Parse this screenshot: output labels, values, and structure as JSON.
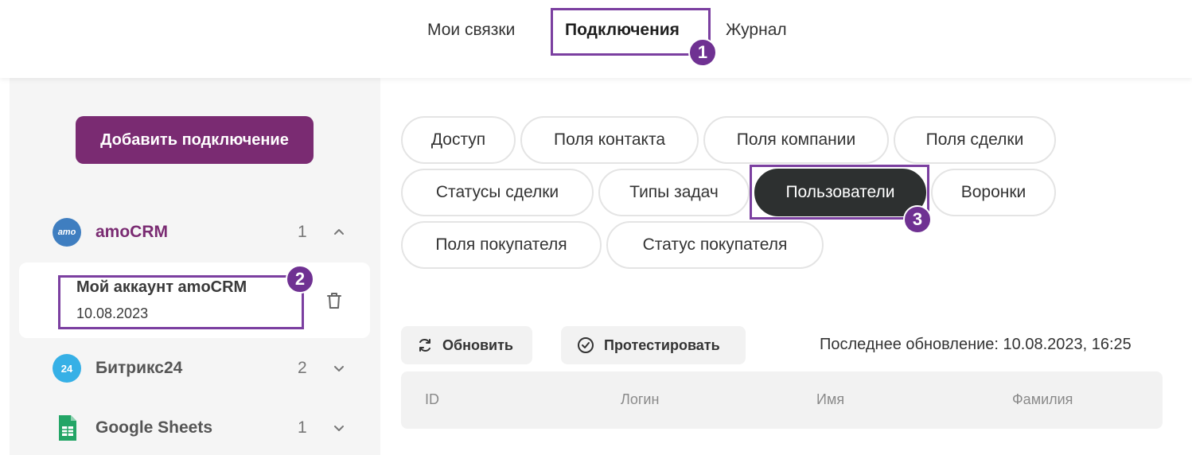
{
  "nav": {
    "tabs": [
      {
        "label": "Мои связки"
      },
      {
        "label": "Подключения",
        "active": true
      },
      {
        "label": "Журнал"
      }
    ]
  },
  "annotations": [
    "1",
    "2",
    "3"
  ],
  "sidebar": {
    "add_button": "Добавить подключение",
    "providers": [
      {
        "name": "amoCRM",
        "count": "1",
        "logo_text": "amo",
        "expanded": true,
        "color": "#3f7ec0"
      },
      {
        "name": "Битрикс24",
        "count": "2",
        "logo_text": "24",
        "expanded": false,
        "color": "#36b0e6"
      },
      {
        "name": "Google Sheets",
        "count": "1",
        "expanded": false,
        "color": "#23a566"
      }
    ],
    "account": {
      "name": "Мой аккаунт amoCRM",
      "date": "10.08.2023"
    }
  },
  "chips": [
    {
      "label": "Доступ"
    },
    {
      "label": "Поля контакта"
    },
    {
      "label": "Поля компании"
    },
    {
      "label": "Поля сделки"
    },
    {
      "label": "Статусы сделки"
    },
    {
      "label": "Типы задач"
    },
    {
      "label": "Пользователи",
      "active": true
    },
    {
      "label": "Воронки"
    },
    {
      "label": "Поля покупателя"
    },
    {
      "label": "Статус покупателя"
    }
  ],
  "actions": {
    "refresh": "Обновить",
    "test": "Протестировать",
    "last_update": "Последнее обновление: 10.08.2023, 16:25"
  },
  "table": {
    "columns": [
      "ID",
      "Логин",
      "Имя",
      "Фамилия"
    ]
  },
  "colors": {
    "accent": "#7a2b72",
    "highlight": "#7b3fa0",
    "badge": "#6f3192",
    "active_chip": "#2d3030"
  }
}
